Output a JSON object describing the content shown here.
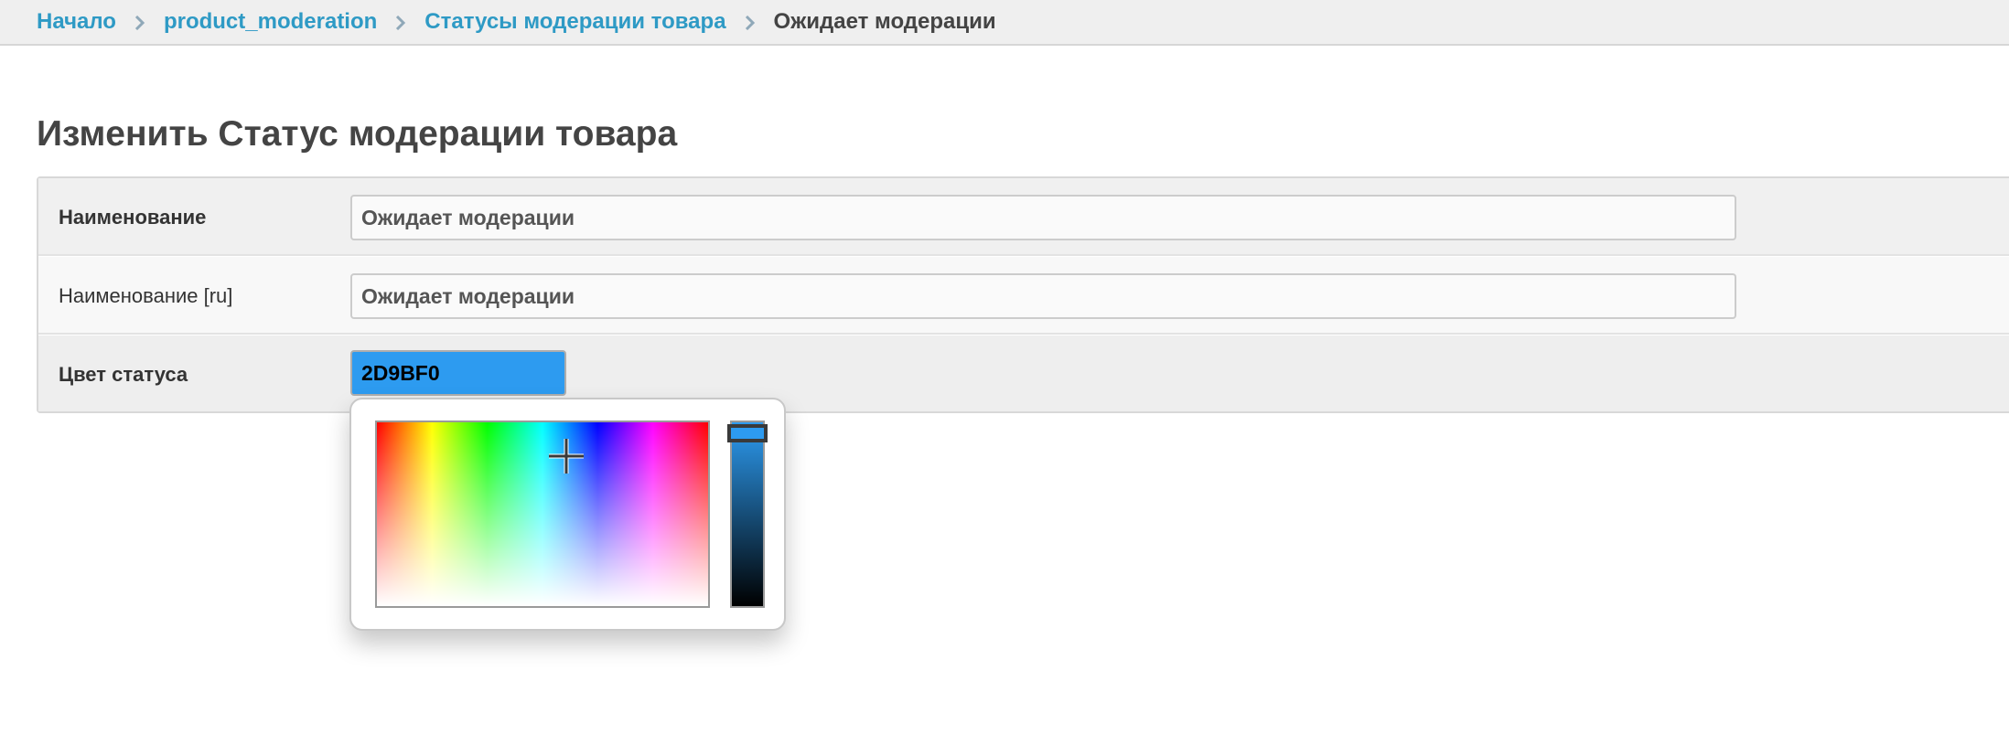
{
  "breadcrumbs": {
    "home": "Начало",
    "app": "product_moderation",
    "model": "Статусы модерации товара",
    "current": "Ожидает модерации"
  },
  "page": {
    "title": "Изменить Статус модерации товара"
  },
  "form": {
    "name": {
      "label": "Наименование",
      "value": "Ожидает модерации"
    },
    "name_ru": {
      "label": "Наименование [ru]",
      "value": "Ожидает модерации"
    },
    "status_color": {
      "label": "Цвет статуса",
      "value": "2D9BF0"
    }
  },
  "colors": {
    "accent_link": "#2e9ac5",
    "selected_color": "#2D9BF0"
  },
  "icons": {
    "breadcrumb_separator": "chevron-right-icon",
    "picker_cursor": "crosshair-icon"
  }
}
